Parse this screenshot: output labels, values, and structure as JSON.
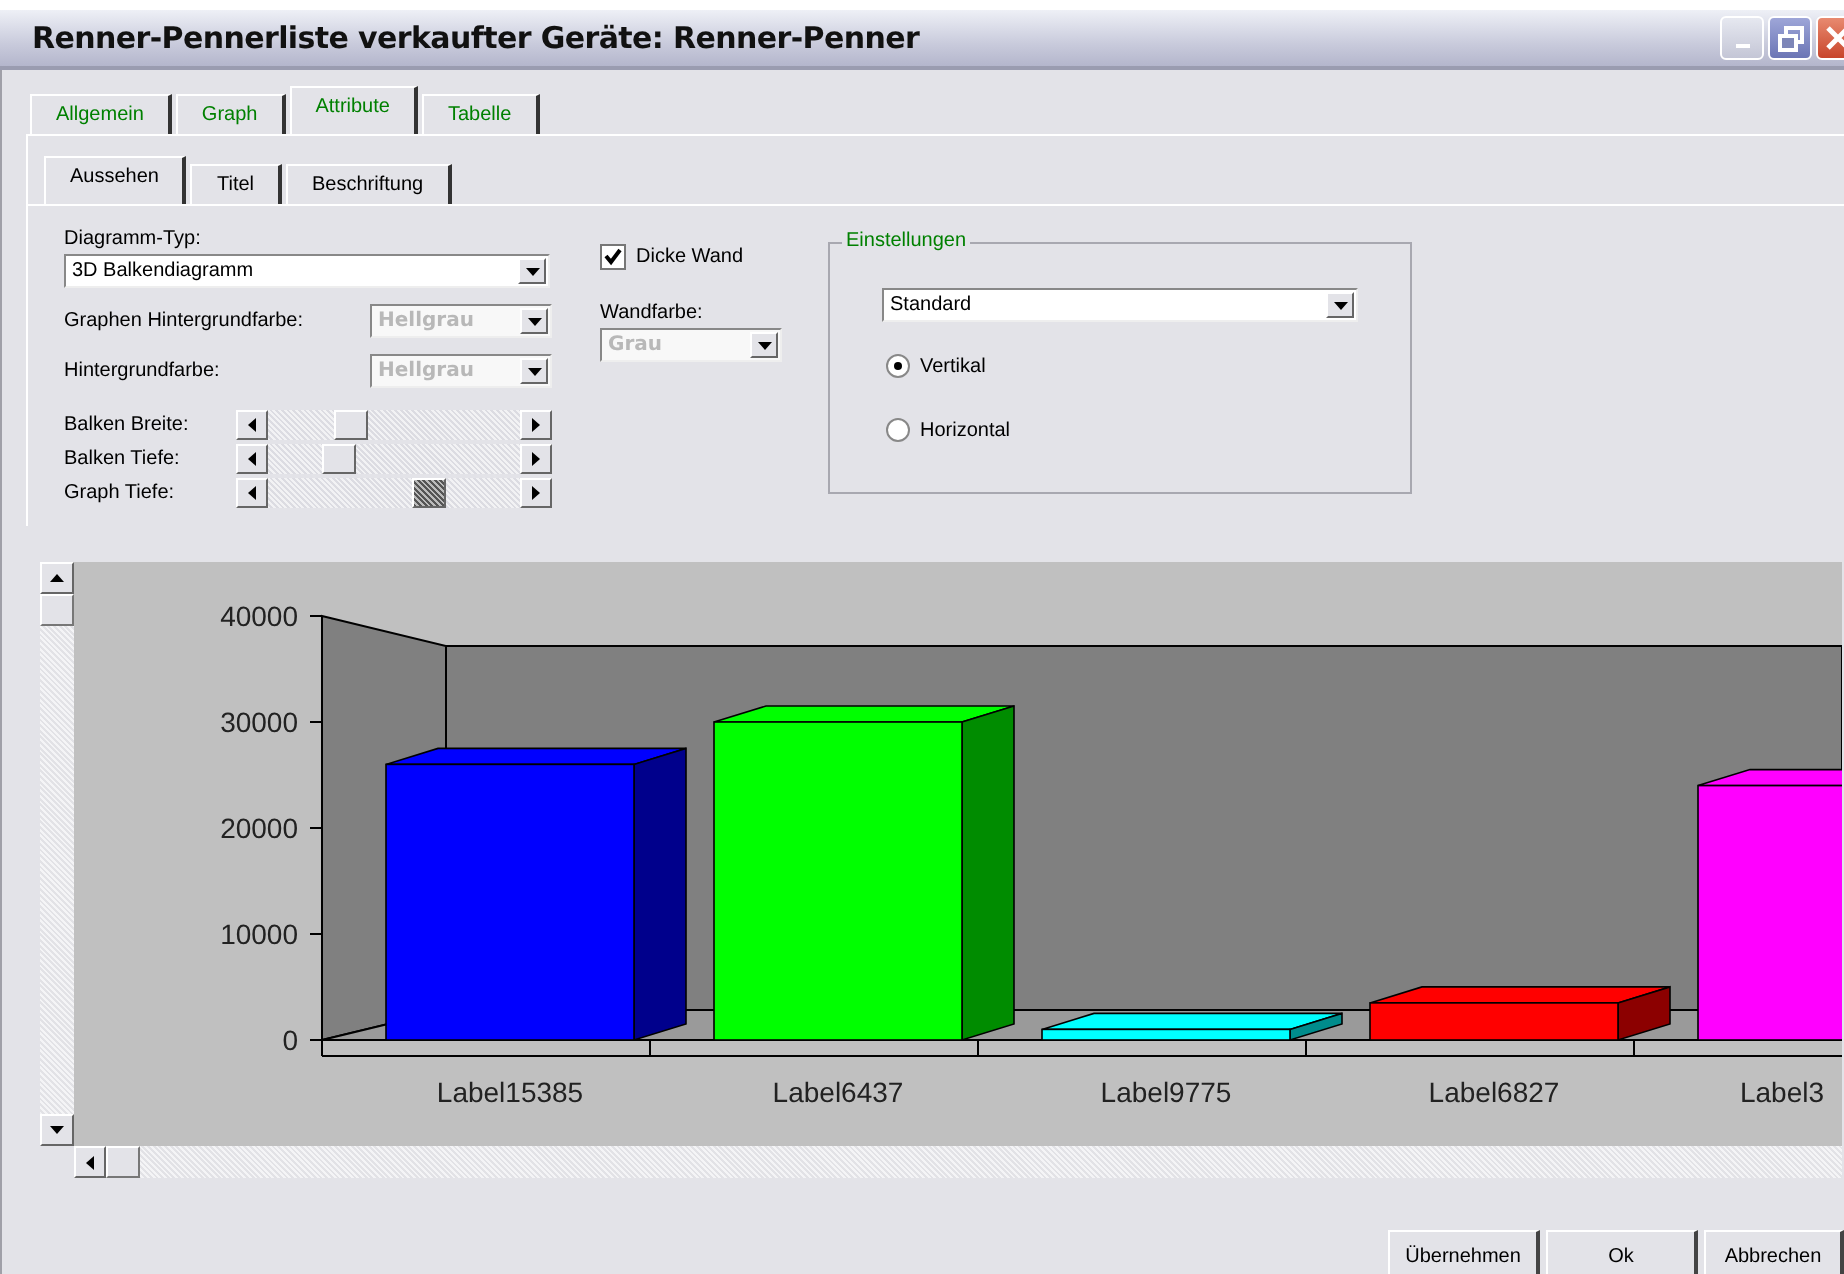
{
  "window": {
    "title": "Renner-Pennerliste verkaufter Geräte: Renner-Penner",
    "controls": [
      {
        "kind": "minimize",
        "disabled": true
      },
      {
        "kind": "restore",
        "disabled": false
      },
      {
        "kind": "close",
        "disabled": false
      }
    ]
  },
  "tabs": [
    {
      "label": "Allgemein",
      "selected": false
    },
    {
      "label": "Graph",
      "selected": false
    },
    {
      "label": "Attribute",
      "selected": true
    },
    {
      "label": "Tabelle",
      "selected": false
    }
  ],
  "subtabs": [
    {
      "label": "Aussehen",
      "selected": true
    },
    {
      "label": "Titel",
      "selected": false
    },
    {
      "label": "Beschriftung",
      "selected": false
    }
  ],
  "diagram_type": {
    "label": "Diagramm-Typ:",
    "value": "3D Balkendiagramm",
    "disabled": false
  },
  "color_selects": [
    {
      "label": "Graphen Hintergrundfarbe:",
      "value": "Hellgrau",
      "disabled": true
    },
    {
      "label": "Hintergrundfarbe:",
      "value": "Hellgrau",
      "disabled": true
    }
  ],
  "sliders": [
    {
      "label": "Balken Breite:",
      "level": 0.3,
      "focused": false
    },
    {
      "label": "Balken Tiefe:",
      "level": 0.25,
      "focused": false
    },
    {
      "label": "Graph Tiefe:",
      "level": 0.66,
      "focused": true
    }
  ],
  "thick_wall": {
    "label": "Dicke Wand",
    "checked": true
  },
  "wall_color": {
    "label": "Wandfarbe:",
    "value": "Grau",
    "disabled": true
  },
  "settings": {
    "title": "Einstellungen",
    "style": {
      "value": "Standard",
      "disabled": false
    },
    "orientation": [
      {
        "label": "Vertikal",
        "selected": true
      },
      {
        "label": "Horizontal",
        "selected": false
      }
    ]
  },
  "chart_data": {
    "type": "bar",
    "categories": [
      "Label15385",
      "Label6437",
      "Label9775",
      "Label6827",
      "Label3"
    ],
    "values": [
      26000,
      30000,
      1000,
      3500,
      24000
    ],
    "colors": [
      "#0000ff",
      "#00ff00",
      "#00ffff",
      "#ff0000",
      "#ff00ff"
    ],
    "ylim": [
      0,
      40000
    ],
    "yticks": [
      0,
      10000,
      20000,
      30000,
      40000
    ]
  },
  "buttons": [
    {
      "label": "Übernehmen"
    },
    {
      "label": "Ok"
    },
    {
      "label": "Abbrechen"
    }
  ]
}
